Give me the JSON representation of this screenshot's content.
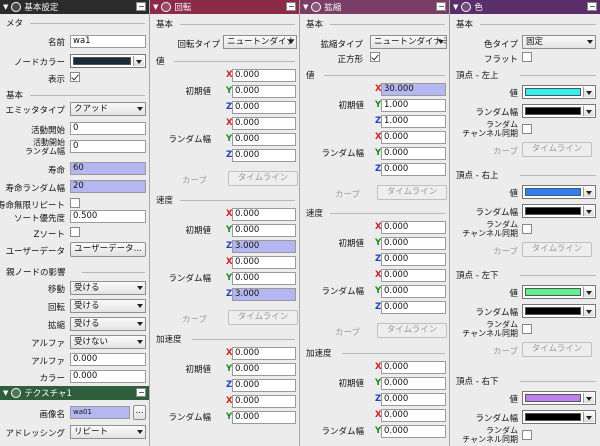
{
  "colors": {
    "panel1_header": "#2b2b2b",
    "panel2_header": "#8c2a4a",
    "panel3_header": "#7a3e66",
    "panel4_header": "#5a2f69",
    "texture_header": "#2f5e3d"
  },
  "panel1": {
    "header": "基本設定",
    "meta": {
      "title": "メタ",
      "name_label": "名前",
      "name_value": "wa1",
      "node_color_label": "ノードカラー",
      "display_label": "表示"
    },
    "basic": {
      "title": "基本",
      "emitter_type_label": "エミッタタイプ",
      "emitter_type_value": "クアッド",
      "active_start_label": "活動開始",
      "active_start_value": "0",
      "active_start_random_label": "活動開始\nランダム幅",
      "active_start_random_value": "0",
      "life_label": "寿命",
      "life_value": "60",
      "life_random_label": "寿命ランダム幅",
      "life_random_value": "20",
      "infinite_repeat_label": "寿命無限リピート",
      "sort_priority_label": "ソート優先度",
      "sort_priority_value": "0.500",
      "zsort_label": "Zソート",
      "user_data_label": "ユーザーデータ",
      "user_data_button": "ユーザーデータ..."
    },
    "parent": {
      "title": "親ノードの影響",
      "move_label": "移動",
      "move_value": "受ける",
      "rotate_label": "回転",
      "rotate_value": "受ける",
      "scale_label": "拡縮",
      "scale_value": "受ける",
      "alpha_label": "アルファ",
      "alpha_value": "受けない",
      "alpha2_label": "アルファ",
      "alpha2_value": "0.000",
      "color_label": "カラー",
      "color_value": "0.000"
    },
    "texture": {
      "header": "テクスチャ1",
      "image_label": "画像名",
      "image_value": "wa01",
      "more_button": "...",
      "addressing_label": "アドレッシング",
      "addressing_value": "リピート"
    }
  },
  "panel2": {
    "header": "回転",
    "basic": {
      "title": "基本",
      "rot_type_label": "回転タイプ",
      "rot_type_value": "ニュートンダイナミ"
    },
    "value": {
      "title": "値",
      "initial_label": "初期値",
      "initial": [
        "0.000",
        "0.000",
        "0.000"
      ],
      "random_label": "ランダム幅",
      "random": [
        "0.000",
        "0.000",
        "0.000"
      ],
      "curve_label": "カーブ",
      "timeline_button": "タイムライン"
    },
    "speed": {
      "title": "速度",
      "initial_label": "初期値",
      "initial": [
        "0.000",
        "0.000",
        "3.000"
      ],
      "random_label": "ランダム幅",
      "random": [
        "0.000",
        "0.000",
        "3.000"
      ],
      "curve_label": "カーブ",
      "timeline_button": "タイムライン"
    },
    "accel": {
      "title": "加速度",
      "initial_label": "初期値",
      "initial": [
        "0.000",
        "0.000",
        "0.000"
      ],
      "random_label": "ランダム幅",
      "random": [
        "0.000",
        "0.000"
      ]
    }
  },
  "panel3": {
    "header": "拡縮",
    "basic": {
      "title": "基本",
      "scale_type_label": "拡縮タイプ",
      "scale_type_value": "ニュートンダイナミ",
      "square_label": "正方形"
    },
    "value": {
      "title": "値",
      "initial_label": "初期値",
      "initial": [
        "30.000",
        "1.000",
        "1.000"
      ],
      "random_label": "ランダム幅",
      "random": [
        "0.000",
        "0.000",
        "0.000"
      ],
      "curve_label": "カーブ",
      "timeline_button": "タイムライン"
    },
    "speed": {
      "title": "速度",
      "initial_label": "初期値",
      "initial": [
        "0.000",
        "0.000",
        "0.000"
      ],
      "random_label": "ランダム幅",
      "random": [
        "0.000",
        "0.000",
        "0.000"
      ],
      "curve_label": "カーブ",
      "timeline_button": "タイムライン"
    },
    "accel": {
      "title": "加速度",
      "initial_label": "初期値",
      "initial": [
        "0.000",
        "0.000",
        "0.000"
      ],
      "random_label": "ランダム幅",
      "random": [
        "0.000",
        "0.000"
      ]
    }
  },
  "panel4": {
    "header": "色",
    "basic": {
      "title": "基本",
      "color_type_label": "色タイプ",
      "color_type_value": "固定",
      "flat_label": "フラット"
    },
    "corners": [
      {
        "title": "頂点 - 左上",
        "value_label": "値",
        "color": "#33f0f0",
        "random_label": "ランダム幅",
        "random_color": "#000000",
        "channel_sync_label": "ランダム\nチャンネル同期",
        "curve_label": "カーブ",
        "timeline_button": "タイムライン"
      },
      {
        "title": "頂点 - 右上",
        "value_label": "値",
        "color": "#2a7fff",
        "random_label": "ランダム幅",
        "random_color": "#000000",
        "channel_sync_label": "ランダム\nチャンネル同期",
        "curve_label": "カーブ",
        "timeline_button": "タイムライン"
      },
      {
        "title": "頂点 - 左下",
        "value_label": "値",
        "color": "#5ff090",
        "random_label": "ランダム幅",
        "random_color": "#000000",
        "channel_sync_label": "ランダム\nチャンネル同期",
        "curve_label": "カーブ",
        "timeline_button": "タイムライン"
      },
      {
        "title": "頂点 - 右下",
        "value_label": "値",
        "color": "#c07ff0",
        "random_label": "ランダム幅",
        "random_color": "#000000",
        "channel_sync_label": "ランダム\nチャンネル同期"
      }
    ]
  },
  "axes": [
    "X",
    "Y",
    "Z"
  ]
}
